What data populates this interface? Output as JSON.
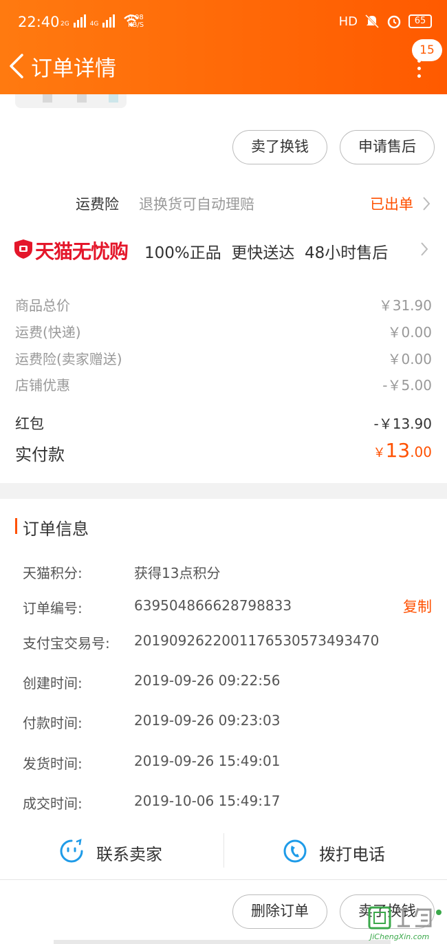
{
  "status_bar": {
    "time": "22:40",
    "net1": "2G",
    "net2": "4G",
    "speed_value": "0.08",
    "speed_unit": "KB/S",
    "hd": "HD",
    "battery": "65"
  },
  "header": {
    "title": "订单详情",
    "badge_count": "15"
  },
  "actions_top": {
    "sell_label": "卖了换钱",
    "after_sale_label": "申请售后"
  },
  "shipping_insurance": {
    "title": "运费险",
    "desc": "退换货可自动理赔",
    "status": "已出单"
  },
  "tmall": {
    "logo_text": "天猫无忧购",
    "perks": "100%正品  更快送达  48小时售后"
  },
  "price_rows": [
    {
      "label": "商品总价",
      "value": "￥31.90"
    },
    {
      "label": "运费(快递)",
      "value": "￥0.00"
    },
    {
      "label": "运费险(卖家赠送)",
      "value": "￥0.00"
    },
    {
      "label": "店铺优惠",
      "value": "-￥5.00"
    }
  ],
  "red_packet": {
    "label": "红包",
    "value": "-￥13.90"
  },
  "paid": {
    "label": "实付款",
    "currency": "￥",
    "integer": "13",
    "decimal": ".00"
  },
  "order_info": {
    "title": "订单信息",
    "copy_label": "复制",
    "rows": [
      {
        "label": "天猫积分:",
        "value": "获得13点积分"
      },
      {
        "label": "订单编号:",
        "value": "639504866628798833"
      },
      {
        "label": "支付宝交易号:",
        "value": "2019092622001176530573493470"
      },
      {
        "label": "创建时间:",
        "value": "2019-09-26 09:22:56"
      },
      {
        "label": "付款时间:",
        "value": "2019-09-26 09:23:03"
      },
      {
        "label": "发货时间:",
        "value": "2019-09-26 15:49:01"
      },
      {
        "label": "成交时间:",
        "value": "2019-10-06 15:49:17"
      }
    ]
  },
  "contact": {
    "seller_label": "联系卖家",
    "call_label": "拨打电话"
  },
  "actions_bottom": {
    "delete_label": "删除订单",
    "sell_label": "卖了换钱"
  },
  "watermark": {
    "text": "JiChengXin.com"
  },
  "colors": {
    "accent": "#ff5000",
    "header_start": "#ff7a10",
    "header_end": "#ff5a00",
    "tmall_red": "#e4162a",
    "contact_blue": "#1e9be8"
  }
}
